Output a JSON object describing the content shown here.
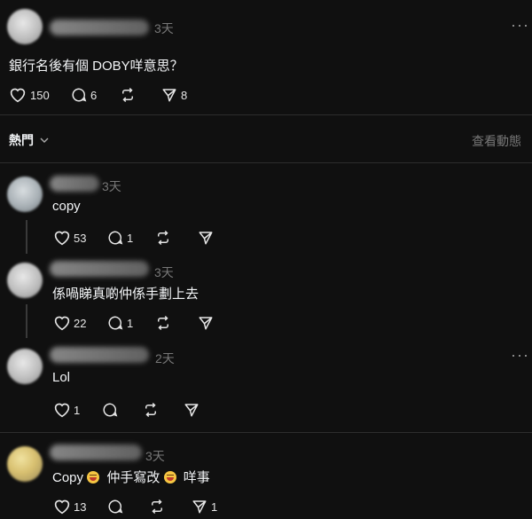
{
  "post": {
    "time": "3天",
    "text": "銀行名後有個 DOBY咩意思？",
    "likes": "150",
    "comments": "6",
    "shares": "8",
    "more": "···"
  },
  "sort": {
    "label": "熱門",
    "view_activity": "查看動態"
  },
  "replies": [
    {
      "time": "3天",
      "text": "copy",
      "likes": "53",
      "comments": "1"
    },
    {
      "time": "3天",
      "text": "係喎睇真啲仲係手劃上去",
      "likes": "22",
      "comments": "1"
    },
    {
      "time": "2天",
      "text": "Lol",
      "likes": "1"
    },
    {
      "time": "3天",
      "text_a": "Copy",
      "text_b": "仲手寫改",
      "text_c": "咩事",
      "likes": "13",
      "shares": "1"
    }
  ]
}
